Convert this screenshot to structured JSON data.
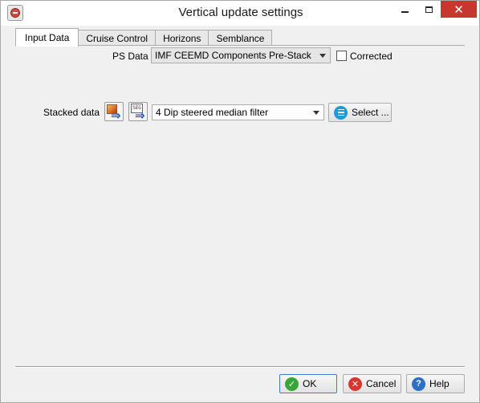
{
  "window": {
    "title": "Vertical update settings",
    "icons": {
      "app": "app-logo-icon",
      "minimize": "minimize-icon",
      "maximize": "maximize-icon",
      "close": "close-icon"
    }
  },
  "tabs": [
    {
      "label": "Input Data",
      "active": true
    },
    {
      "label": "Cruise Control",
      "active": false
    },
    {
      "label": "Horizons",
      "active": false
    },
    {
      "label": "Semblance",
      "active": false
    }
  ],
  "input_data": {
    "ps_data_label": "PS Data",
    "ps_data_value": "IMF CEEMD Components Pre-Stack",
    "corrected_label": "Corrected",
    "corrected_checked": false,
    "stacked_data_label": "Stacked data",
    "stacked_data_value": "4 Dip steered median filter",
    "select_button_label": "Select ...",
    "import_icon": "import-icon",
    "segy_import_icon": "segy-import-icon"
  },
  "footer": {
    "ok_label": "OK",
    "cancel_label": "Cancel",
    "help_label": "Help"
  },
  "colors": {
    "close_button": "#c7372f",
    "ok_icon": "#3aa63a",
    "cancel_icon": "#d8362f",
    "help_icon": "#2d6fc4",
    "select_icon": "#1e9ad6"
  }
}
